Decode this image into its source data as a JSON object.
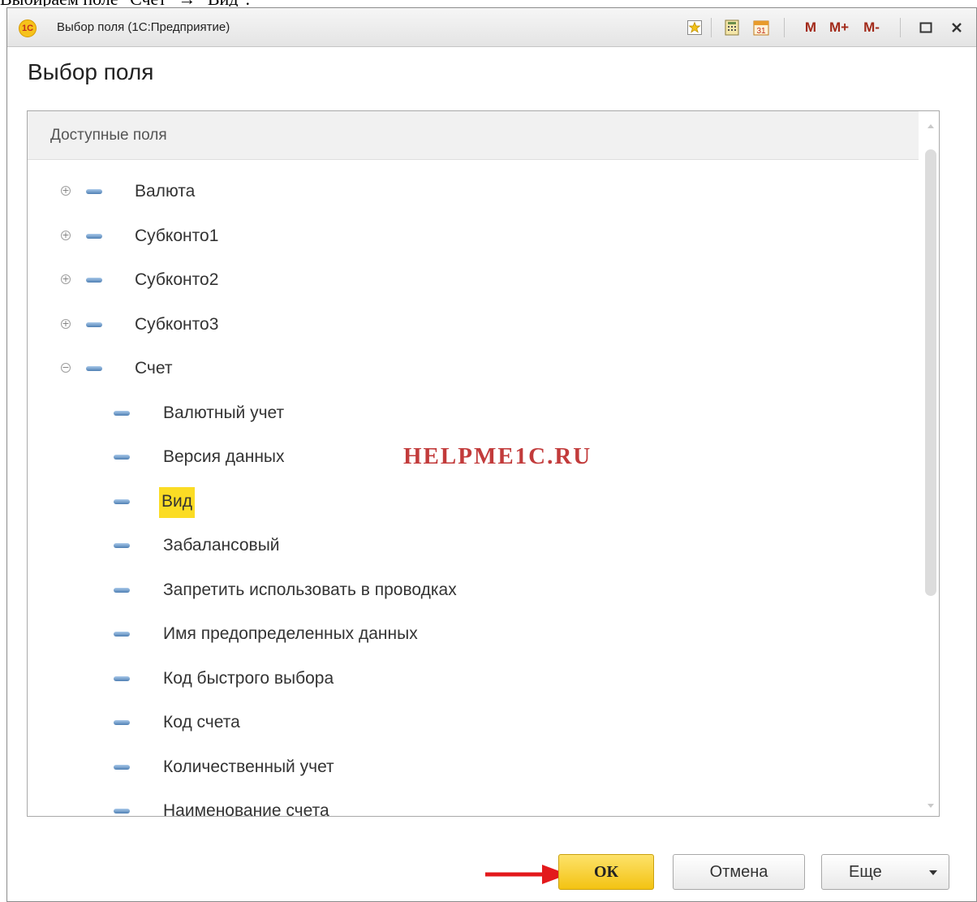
{
  "caption": "Выбираем поле \"Счет\" → \"Вид\".",
  "window": {
    "title": "Выбор поля  (1С:Предприятие)",
    "logo_text": "1С",
    "toolbar": {
      "m": "M",
      "m_plus": "M+",
      "m_minus": "M-",
      "calendar_day": "31"
    }
  },
  "heading": "Выбор поля",
  "panel": {
    "header": "Доступные поля",
    "items": [
      {
        "label": "Валюта",
        "expander": "+"
      },
      {
        "label": "Субконто1",
        "expander": "+"
      },
      {
        "label": "Субконто2",
        "expander": "+"
      },
      {
        "label": "Субконто3",
        "expander": "+"
      },
      {
        "label": "Счет",
        "expander": "−"
      },
      {
        "label": "Валютный учет"
      },
      {
        "label": "Версия данных"
      },
      {
        "label": "Вид",
        "selected": true
      },
      {
        "label": "Забалансовый"
      },
      {
        "label": "Запретить использовать в проводках"
      },
      {
        "label": "Имя предопределенных данных"
      },
      {
        "label": "Код быстрого выбора"
      },
      {
        "label": "Код счета"
      },
      {
        "label": "Количественный учет"
      },
      {
        "label": "Наименование счета"
      }
    ]
  },
  "watermark": "HELPME1C.RU",
  "buttons": {
    "ok": "ОК",
    "cancel": "Отмена",
    "more": "Еще"
  },
  "colors": {
    "highlight": "#fbdc24",
    "ok_button": "#f3c313",
    "arrow": "#e3191c"
  }
}
